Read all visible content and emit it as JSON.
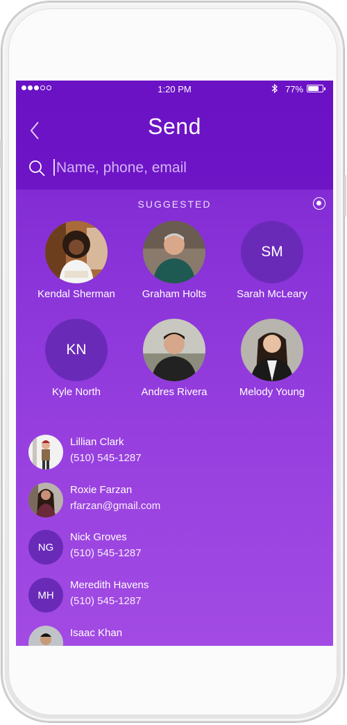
{
  "status_bar": {
    "time": "1:20 PM",
    "battery_percent": "77%",
    "signal_bars_filled": 3,
    "signal_bars_total": 5,
    "battery_level": 0.77
  },
  "header": {
    "title": "Send",
    "back_icon": "chevron-left-icon",
    "search_placeholder": "Name, phone, email",
    "search_value": ""
  },
  "suggested": {
    "section_title": "SUGGESTED",
    "people": [
      {
        "name": "Kendal Sherman",
        "photo": true
      },
      {
        "name": "Graham Holts",
        "photo": true
      },
      {
        "name": "Sarah McLeary",
        "initials": "SM"
      },
      {
        "name": "Kyle North",
        "initials": "KN"
      },
      {
        "name": "Andres Rivera",
        "photo": true
      },
      {
        "name": "Melody Young",
        "photo": true
      }
    ]
  },
  "contacts": [
    {
      "name": "Lillian Clark",
      "detail": "(510) 545-1287",
      "photo": true
    },
    {
      "name": "Roxie Farzan",
      "detail": "rfarzan@gmail.com",
      "photo": true
    },
    {
      "name": "Nick Groves",
      "detail": "(510) 545-1287",
      "initials": "NG"
    },
    {
      "name": "Meredith Havens",
      "detail": "(510) 545-1287",
      "initials": "MH"
    },
    {
      "name": "Isaac Khan",
      "detail": "",
      "photo": true
    }
  ],
  "colors": {
    "header_bg": "#6a12c4",
    "list_bg_top": "#7a22cf",
    "list_bg_bottom": "#a24ae3",
    "initials_bg": "#6a2ab8"
  }
}
